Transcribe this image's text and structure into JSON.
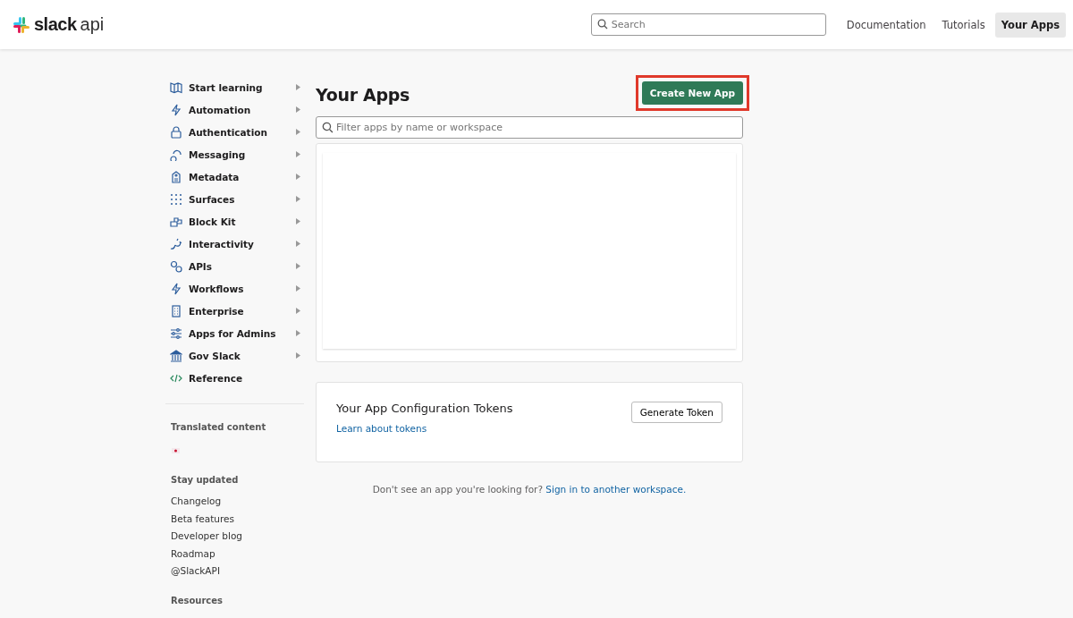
{
  "header": {
    "logo": {
      "wordmark": "slack",
      "suffix": "api"
    },
    "search": {
      "placeholder": "Search"
    },
    "nav": [
      {
        "label": "Documentation",
        "selected": false
      },
      {
        "label": "Tutorials",
        "selected": false
      },
      {
        "label": "Your Apps",
        "selected": true
      }
    ]
  },
  "sidebar": {
    "items": [
      {
        "label": "Start learning",
        "expandable": true
      },
      {
        "label": "Automation",
        "expandable": true
      },
      {
        "label": "Authentication",
        "expandable": true
      },
      {
        "label": "Messaging",
        "expandable": true
      },
      {
        "label": "Metadata",
        "expandable": true
      },
      {
        "label": "Surfaces",
        "expandable": true
      },
      {
        "label": "Block Kit",
        "expandable": true
      },
      {
        "label": "Interactivity",
        "expandable": true
      },
      {
        "label": "APIs",
        "expandable": true
      },
      {
        "label": "Workflows",
        "expandable": true
      },
      {
        "label": "Enterprise",
        "expandable": true
      },
      {
        "label": "Apps for Admins",
        "expandable": true
      },
      {
        "label": "Gov Slack",
        "expandable": true
      },
      {
        "label": "Reference",
        "expandable": false
      }
    ],
    "translated_heading": "Translated content",
    "stay_updated_heading": "Stay updated",
    "links": [
      "Changelog",
      "Beta features",
      "Developer blog",
      "Roadmap",
      "@SlackAPI"
    ],
    "resources_heading": "Resources"
  },
  "main": {
    "title": "Your Apps",
    "create_button": {
      "label": "Create New App",
      "highlighted": true
    },
    "filter": {
      "placeholder": "Filter apps by name or workspace"
    },
    "tokens": {
      "title": "Your App Configuration Tokens",
      "link": "Learn about tokens",
      "button": "Generate Token"
    },
    "footer": {
      "prompt": "Don't see an app you're looking for?",
      "link": "Sign in to another workspace."
    }
  }
}
